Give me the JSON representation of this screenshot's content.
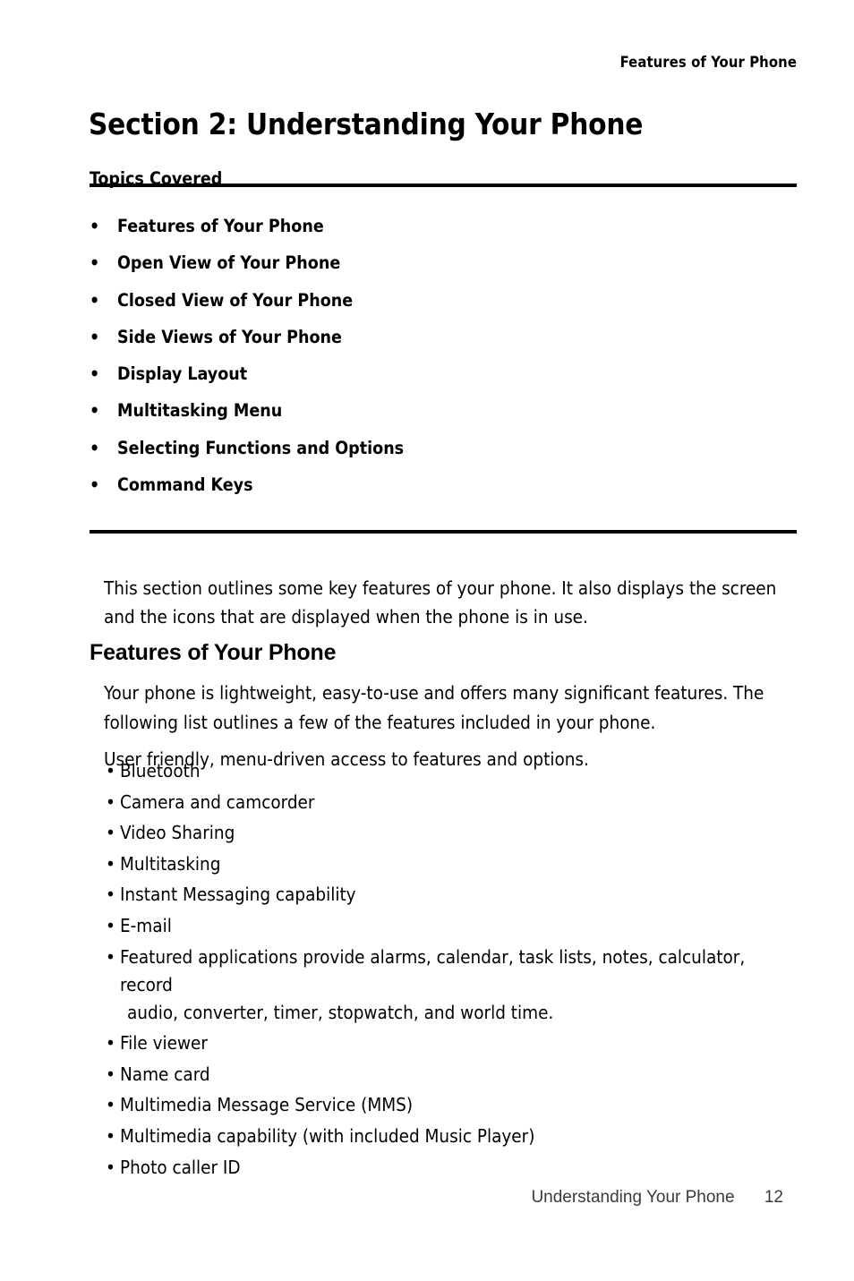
{
  "header": {
    "running_title": "Features of Your Phone"
  },
  "section": {
    "title": "Section 2: Understanding Your Phone"
  },
  "topics": {
    "heading": "Topics Covered",
    "bullet_glyph": "•",
    "items": [
      {
        "label": "Features of Your Phone"
      },
      {
        "label": "Open View of Your Phone"
      },
      {
        "label": "Closed View of Your Phone"
      },
      {
        "label": "Side Views of Your Phone"
      },
      {
        "label": "Display Layout"
      },
      {
        "label": "Multitasking Menu"
      },
      {
        "label": "Selecting Functions and Options"
      },
      {
        "label": "Command Keys"
      }
    ]
  },
  "intro": {
    "paragraph": "This section outlines some key features of your phone. It also displays the screen and the icons that are displayed when the phone is in use."
  },
  "features": {
    "heading": "Features of Your Phone",
    "paragraph1": "Your phone is lightweight, easy-to-use and offers many significant features. The following list outlines a few of the features included in your phone.",
    "paragraph2": "User friendly, menu-driven access to features and options.",
    "bullet_glyph": "•",
    "items": [
      {
        "label": "Bluetooth",
        "cont": ""
      },
      {
        "label": "Camera and camcorder",
        "cont": ""
      },
      {
        "label": "Video Sharing",
        "cont": ""
      },
      {
        "label": "Multitasking",
        "cont": ""
      },
      {
        "label": "Instant Messaging capability",
        "cont": ""
      },
      {
        "label": "E-mail",
        "cont": ""
      },
      {
        "label": "Featured applications provide alarms, calendar, task lists, notes, calculator, record",
        "cont": "audio, converter, timer, stopwatch, and world time."
      },
      {
        "label": "File viewer",
        "cont": ""
      },
      {
        "label": "Name card",
        "cont": ""
      },
      {
        "label": "Multimedia Message Service (MMS)",
        "cont": ""
      },
      {
        "label": "Multimedia capability (with included Music Player)",
        "cont": ""
      },
      {
        "label": "Photo caller ID",
        "cont": ""
      }
    ]
  },
  "footer": {
    "chapter": "Understanding Your Phone",
    "page_number": "12"
  },
  "colors": {
    "text": "#000000",
    "rule": "#000000",
    "footer_text": "#3a3a3a",
    "background": "#ffffff"
  }
}
